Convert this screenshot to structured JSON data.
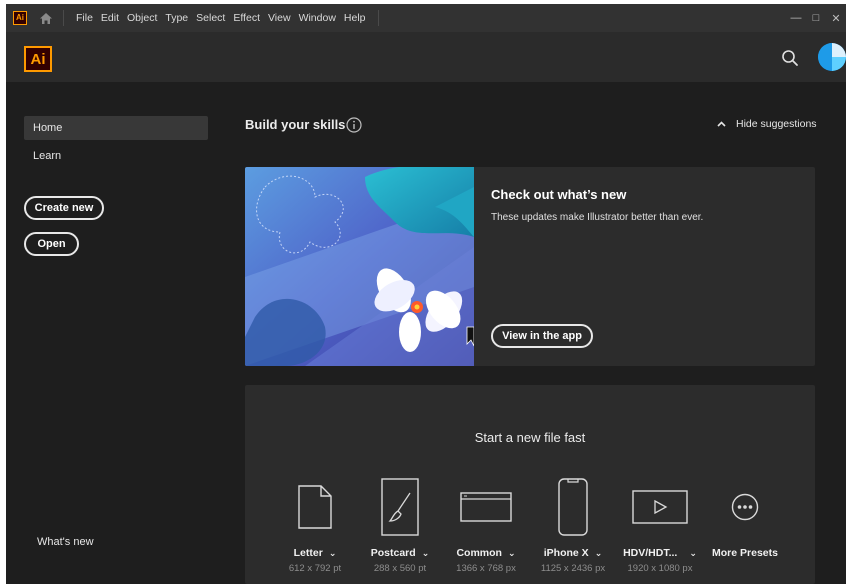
{
  "menubar": {
    "logo_text": "Ai",
    "items": [
      "File",
      "Edit",
      "Object",
      "Type",
      "Select",
      "Effect",
      "View",
      "Window",
      "Help"
    ],
    "controls": {
      "minimize": "—",
      "maximize": "□",
      "close": "✕"
    }
  },
  "header": {
    "logo_text": "Ai",
    "icons": [
      "search-icon",
      "avatar"
    ]
  },
  "sidebar": {
    "nav": [
      {
        "label": "Home",
        "active": true
      },
      {
        "label": "Learn",
        "active": false
      }
    ],
    "create_new": "Create new",
    "open": "Open",
    "whats_new": "What's new"
  },
  "skills": {
    "title": "Build your skills",
    "hide_label": "Hide suggestions",
    "card": {
      "title": "Check out what’s new",
      "description": "These updates make Illustrator better than ever.",
      "button": "View in the app"
    }
  },
  "new_file": {
    "title": "Start a new file fast",
    "presets": [
      {
        "name": "Letter",
        "size": "612 x 792 pt",
        "icon": "document-icon"
      },
      {
        "name": "Postcard",
        "size": "288 x 560 pt",
        "icon": "brush-icon"
      },
      {
        "name": "Common",
        "size": "1366 x 768 px",
        "icon": "browser-icon"
      },
      {
        "name": "iPhone X",
        "size": "1125 x 2436 px",
        "icon": "phone-icon"
      },
      {
        "name": "HDV/HDT...",
        "size": "1920 x 1080 px",
        "icon": "video-icon"
      },
      {
        "name": "More Presets",
        "size": "",
        "icon": "more-icon"
      }
    ]
  },
  "colors": {
    "background": "#1e1e1e",
    "menubar": "#323232",
    "header": "#2b2b2b",
    "card": "#2c2c2c",
    "brand_orange": "#ff9a00",
    "avatar_blue": "#1e9be8"
  }
}
